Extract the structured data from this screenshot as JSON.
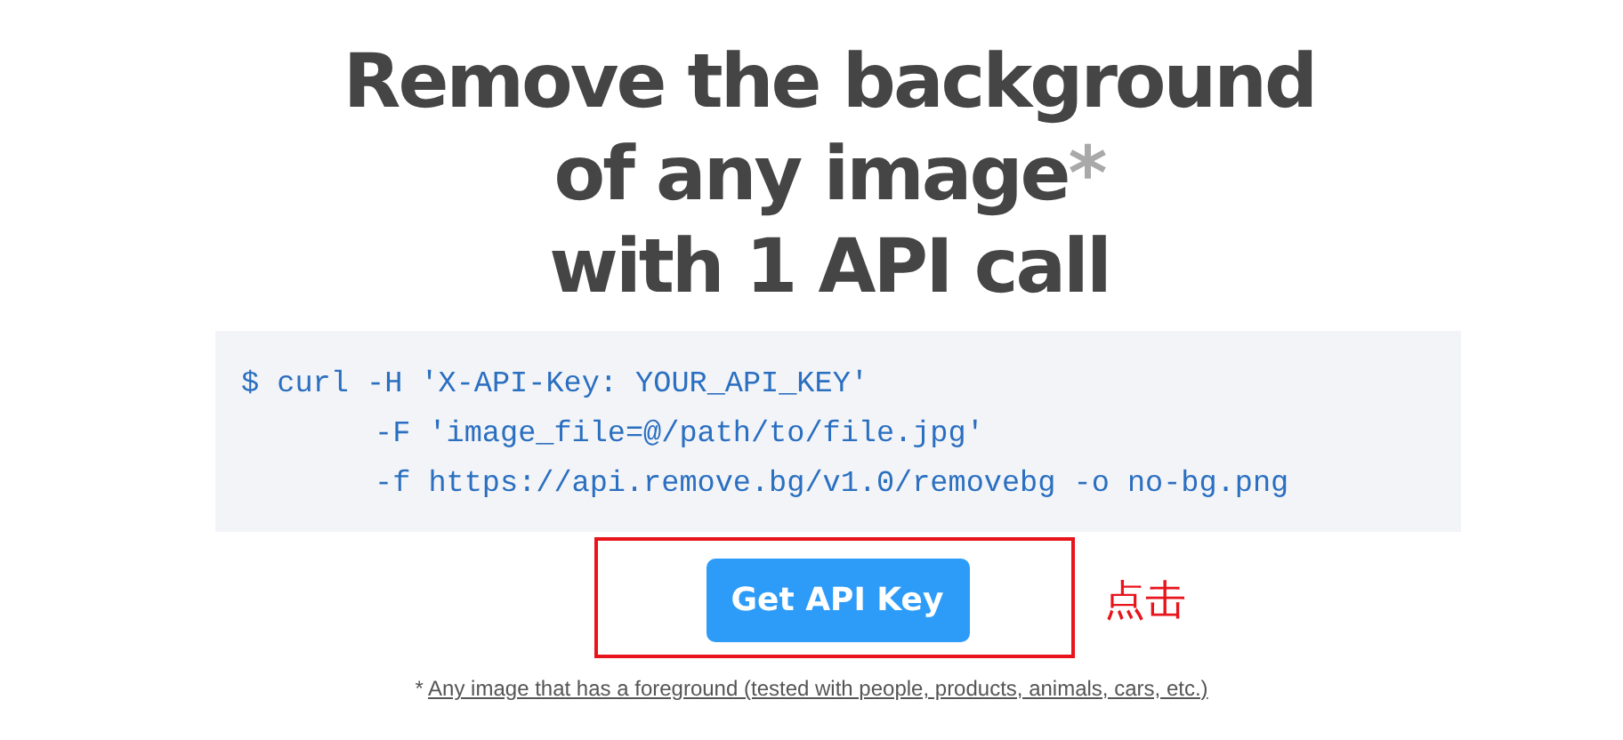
{
  "heading": {
    "lines": [
      {
        "text": "Remove the background"
      },
      {
        "text": "of any image",
        "mark": "*"
      },
      {
        "text": "with 1 API call"
      }
    ]
  },
  "code": {
    "lines": [
      {
        "kind": "command",
        "text": "$ curl -H 'X-API-Key: YOUR_API_KEY'"
      },
      {
        "kind": "continuation",
        "text": "-F 'image_file=@/path/to/file.jpg'"
      },
      {
        "kind": "continuation",
        "text": "-f https://api.remove.bg/v1.0/removebg -o no-bg.png"
      }
    ]
  },
  "button": {
    "label": "Get API Key"
  },
  "annotation": {
    "text": "点击"
  },
  "footnote": {
    "mark": "*",
    "link": "Any image that has a foreground (tested with people, products, animals, cars, etc.)"
  }
}
